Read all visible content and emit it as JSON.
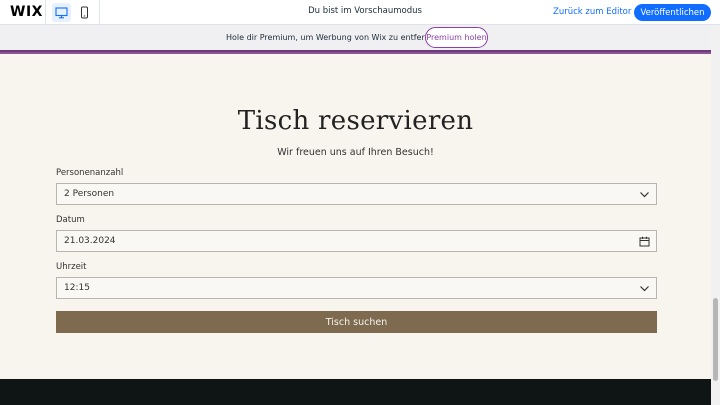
{
  "editor": {
    "logo": "WIX",
    "preview_mode_text": "Du bist im Vorschaumodus",
    "back_to_editor": "Zurück zum Editor",
    "publish": "Veröffentlichen",
    "device_icons": [
      "desktop-icon",
      "mobile-icon"
    ]
  },
  "banner": {
    "text": "Hole dir Premium, um Werbung von Wix zu entfernen.",
    "button": "Premium holen"
  },
  "page": {
    "title": "Tisch reservieren",
    "subtitle": "Wir freuen uns auf Ihren Besuch!",
    "fields": {
      "party_size": {
        "label": "Personenanzahl",
        "value": "2 Personen",
        "icon": "chevron-down-icon"
      },
      "date": {
        "label": "Datum",
        "value": "21.03.2024",
        "icon": "calendar-icon"
      },
      "time": {
        "label": "Uhrzeit",
        "value": "12:15",
        "icon": "chevron-down-icon"
      }
    },
    "submit": "Tisch suchen"
  },
  "colors": {
    "accent_blue": "#116dff",
    "premium_purple": "#8b3fa8",
    "page_bg": "#f8f4ee",
    "button_brown": "#7d6a4f",
    "footer_dark": "#0f1414"
  }
}
